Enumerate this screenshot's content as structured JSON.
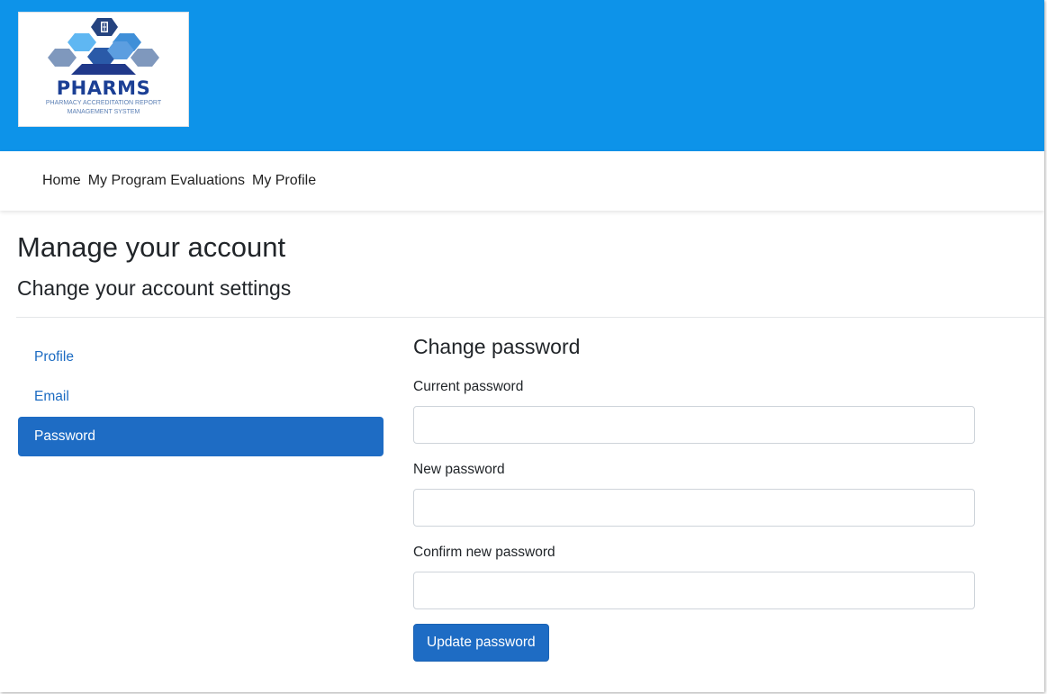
{
  "logo": {
    "name": "PHARMS",
    "subtitle_line1": "PHARMACY ACCREDITATION REPORT",
    "subtitle_line2": "MANAGEMENT SYSTEM"
  },
  "nav": {
    "items": [
      {
        "label": "Home"
      },
      {
        "label": "My Program Evaluations"
      },
      {
        "label": "My Profile"
      }
    ]
  },
  "page": {
    "title": "Manage your account",
    "subtitle": "Change your account settings"
  },
  "sidebar": {
    "items": [
      {
        "label": "Profile",
        "active": false
      },
      {
        "label": "Email",
        "active": false
      },
      {
        "label": "Password",
        "active": true
      }
    ]
  },
  "form": {
    "title": "Change password",
    "current_password_label": "Current password",
    "current_password_value": "",
    "new_password_label": "New password",
    "new_password_value": "",
    "confirm_password_label": "Confirm new password",
    "confirm_password_value": "",
    "submit_label": "Update password"
  },
  "colors": {
    "banner": "#0d93e9",
    "accent": "#1e6cc4",
    "link": "#1c6bc2",
    "logo_text": "#1b3f95"
  }
}
